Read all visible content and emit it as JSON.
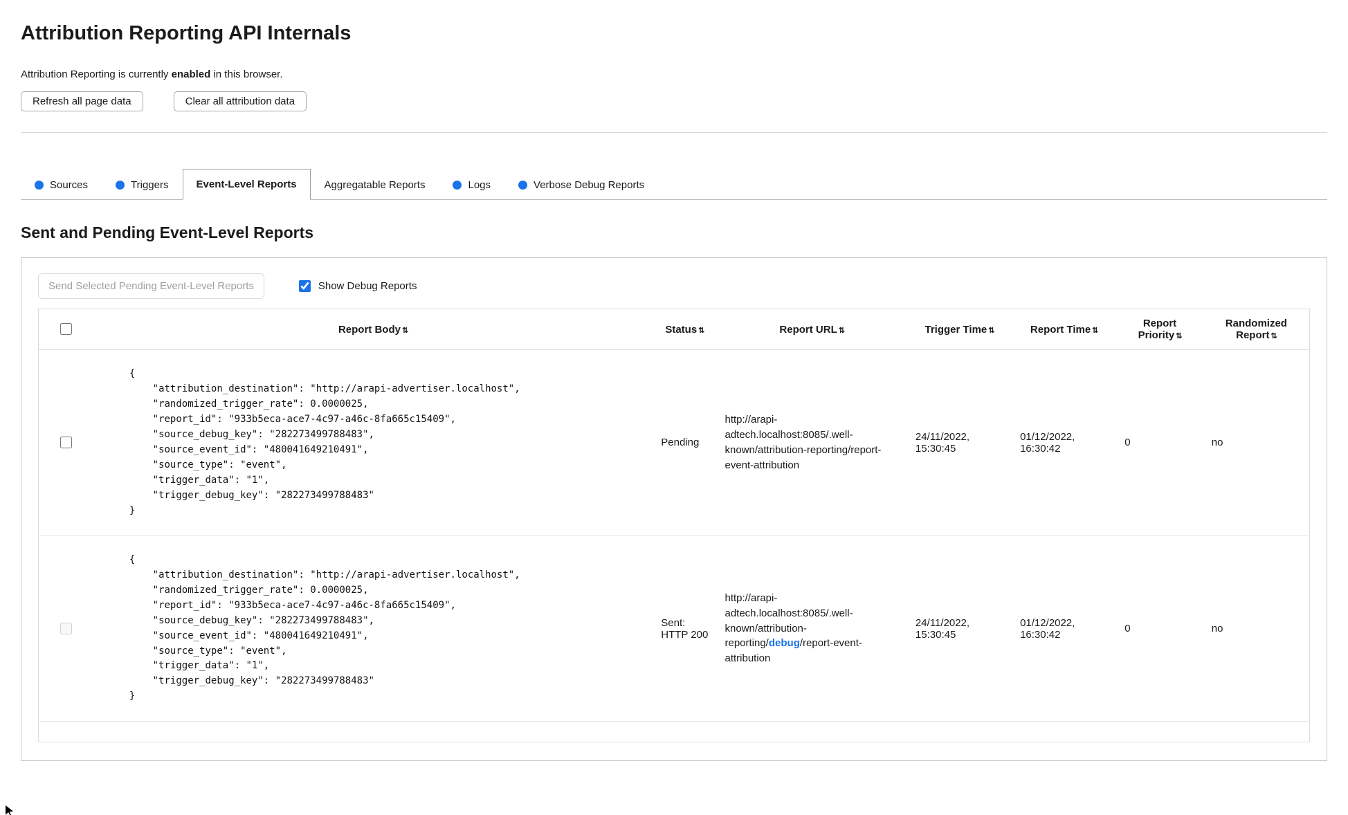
{
  "page": {
    "title": "Attribution Reporting API Internals",
    "status": {
      "prefix": "Attribution Reporting is currently ",
      "emphasis": "enabled",
      "suffix": " in this browser."
    },
    "buttons": {
      "refresh": "Refresh all page data",
      "clear": "Clear all attribution data"
    }
  },
  "tabs": {
    "items": [
      {
        "label": "Sources",
        "has_dot": true,
        "active": false
      },
      {
        "label": "Triggers",
        "has_dot": true,
        "active": false
      },
      {
        "label": "Event-Level Reports",
        "has_dot": false,
        "active": true
      },
      {
        "label": "Aggregatable Reports",
        "has_dot": false,
        "active": false
      },
      {
        "label": "Logs",
        "has_dot": true,
        "active": false
      },
      {
        "label": "Verbose Debug Reports",
        "has_dot": true,
        "active": false
      }
    ]
  },
  "section": {
    "heading": "Sent and Pending Event-Level Reports",
    "send_button": "Send Selected Pending Event-Level Reports",
    "show_debug_label": "Show Debug Reports",
    "show_debug_checked": true
  },
  "table": {
    "sort_icon": "⇅",
    "headers": {
      "report_body": "Report Body",
      "status": "Status",
      "report_url": "Report URL",
      "trigger_time": "Trigger Time",
      "report_time": "Report Time",
      "report_priority": "Report Priority",
      "randomized_report": "Randomized Report"
    },
    "rows": [
      {
        "selected": false,
        "checkbox_enabled": true,
        "report_body": "{\n    \"attribution_destination\": \"http://arapi-advertiser.localhost\",\n    \"randomized_trigger_rate\": 0.0000025,\n    \"report_id\": \"933b5eca-ace7-4c97-a46c-8fa665c15409\",\n    \"source_debug_key\": \"282273499788483\",\n    \"source_event_id\": \"480041649210491\",\n    \"source_type\": \"event\",\n    \"trigger_data\": \"1\",\n    \"trigger_debug_key\": \"282273499788483\"\n}",
        "status": "Pending",
        "url_pre": "http://arapi-adtech.localhost:8085/.well-known/attribution-reporting/",
        "url_debug": "",
        "url_post": "report-event-attribution",
        "trigger_time": "24/11/2022, 15:30:45",
        "report_time": "01/12/2022, 16:30:42",
        "report_priority": "0",
        "randomized_report": "no"
      },
      {
        "selected": false,
        "checkbox_enabled": false,
        "report_body": "{\n    \"attribution_destination\": \"http://arapi-advertiser.localhost\",\n    \"randomized_trigger_rate\": 0.0000025,\n    \"report_id\": \"933b5eca-ace7-4c97-a46c-8fa665c15409\",\n    \"source_debug_key\": \"282273499788483\",\n    \"source_event_id\": \"480041649210491\",\n    \"source_type\": \"event\",\n    \"trigger_data\": \"1\",\n    \"trigger_debug_key\": \"282273499788483\"\n}",
        "status": "Sent: HTTP 200",
        "url_pre": "http://arapi-adtech.localhost:8085/.well-known/attribution-reporting/",
        "url_debug": "debug",
        "url_post": "/report-event-attribution",
        "trigger_time": "24/11/2022, 15:30:45",
        "report_time": "01/12/2022, 16:30:42",
        "report_priority": "0",
        "randomized_report": "no"
      }
    ]
  },
  "colors": {
    "accent_blue": "#1a73e8",
    "debug_segment": "#1a73e8"
  }
}
